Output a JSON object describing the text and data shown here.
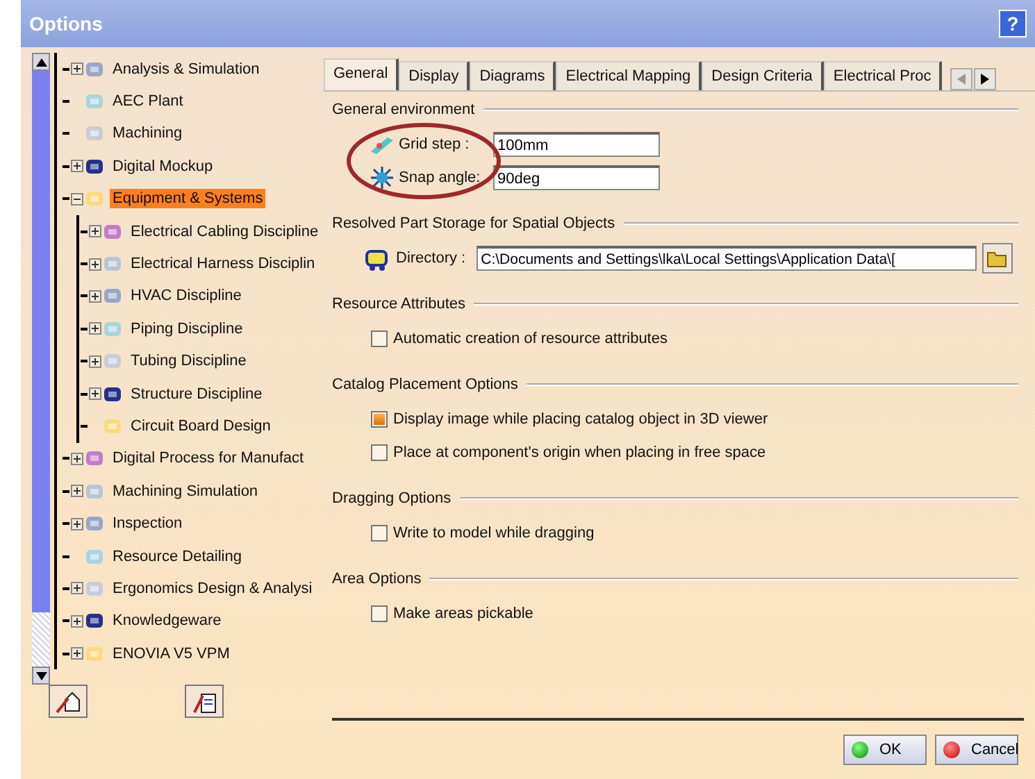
{
  "window": {
    "title": "Options",
    "help_button": "?"
  },
  "tree": [
    {
      "label": "Analysis & Simulation",
      "expandable": true,
      "selected": false
    },
    {
      "label": "AEC Plant",
      "expandable": false,
      "selected": false
    },
    {
      "label": "Machining",
      "expandable": false,
      "selected": false
    },
    {
      "label": "Digital Mockup",
      "expandable": true,
      "selected": false
    },
    {
      "label": "Equipment & Systems",
      "expandable": true,
      "selected": true,
      "children": [
        {
          "label": "Electrical Cabling Discipline",
          "expandable": true,
          "selected": false
        },
        {
          "label": "Electrical Harness Disciplin",
          "expandable": true,
          "selected": false
        },
        {
          "label": "HVAC Discipline",
          "expandable": true,
          "selected": false
        },
        {
          "label": "Piping Discipline",
          "expandable": true,
          "selected": false
        },
        {
          "label": "Tubing Discipline",
          "expandable": true,
          "selected": false
        },
        {
          "label": "Structure Discipline",
          "expandable": true,
          "selected": false
        },
        {
          "label": "Circuit Board Design",
          "expandable": false,
          "selected": false
        }
      ]
    },
    {
      "label": "Digital Process for Manufact",
      "expandable": true,
      "selected": false
    },
    {
      "label": "Machining Simulation",
      "expandable": true,
      "selected": false
    },
    {
      "label": "Inspection",
      "expandable": true,
      "selected": false
    },
    {
      "label": "Resource Detailing",
      "expandable": false,
      "selected": false
    },
    {
      "label": "Ergonomics Design & Analysi",
      "expandable": true,
      "selected": false
    },
    {
      "label": "Knowledgeware",
      "expandable": true,
      "selected": false
    },
    {
      "label": "ENOVIA V5 VPM",
      "expandable": true,
      "selected": false
    }
  ],
  "tabs": [
    {
      "label": "General",
      "selected": true
    },
    {
      "label": "Display",
      "selected": false
    },
    {
      "label": "Diagrams",
      "selected": false
    },
    {
      "label": "Electrical Mapping",
      "selected": false
    },
    {
      "label": "Design Criteria",
      "selected": false
    },
    {
      "label": "Electrical Proc",
      "selected": false
    }
  ],
  "sections": [
    {
      "title": "General environment",
      "items": [
        {
          "kind": "field",
          "label": "Grid step :",
          "value": "100mm"
        },
        {
          "kind": "field",
          "label": "Snap angle:",
          "value": "90deg"
        }
      ],
      "annotated": true
    },
    {
      "title": "Resolved Part Storage for Spatial Objects",
      "items": [
        {
          "kind": "path",
          "label": "Directory :",
          "value": "C:\\Documents and Settings\\lka\\Local Settings\\Application Data\\["
        }
      ]
    },
    {
      "title": "Resource Attributes",
      "items": [
        {
          "kind": "checkbox",
          "label": "Automatic creation of resource attributes",
          "checked": false
        }
      ]
    },
    {
      "title": "Catalog Placement Options",
      "items": [
        {
          "kind": "checkbox",
          "label": "Display image while placing catalog object in 3D viewer",
          "checked": true
        },
        {
          "kind": "checkbox",
          "label": "Place at component's origin when placing in free space",
          "checked": false
        }
      ]
    },
    {
      "title": "Dragging Options",
      "items": [
        {
          "kind": "checkbox",
          "label": "Write to model while dragging",
          "checked": false
        }
      ]
    },
    {
      "title": "Area Options",
      "items": [
        {
          "kind": "checkbox",
          "label": "Make areas pickable",
          "checked": false
        }
      ]
    }
  ],
  "buttons": [
    {
      "label": "OK",
      "kind": "ok"
    },
    {
      "label": "Cancel",
      "kind": "cancel"
    }
  ]
}
